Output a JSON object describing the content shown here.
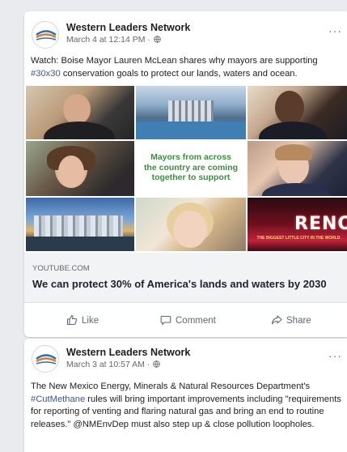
{
  "posts": [
    {
      "page_name": "Western Leaders Network",
      "date": "March 4 at 12:14 PM",
      "text_before": "Watch: Boise Mayor Lauren McLean shares why mayors are supporting ",
      "hashtag": "#30x30",
      "text_after": " conservation goals to protect our lands, waters and ocean.",
      "image_caption_lines": [
        "Mayors from across",
        "the country are coming",
        "together to support"
      ],
      "image_sign": "RENO",
      "image_sign_sub": "THE BIGGEST LITTLE CITY IN THE WORLD",
      "link": {
        "domain": "YOUTUBE.COM",
        "title": "We can protect 30% of America's lands and waters by 2030"
      },
      "actions": {
        "like": "Like",
        "comment": "Comment",
        "share": "Share"
      }
    },
    {
      "page_name": "Western Leaders Network",
      "date": "March 3 at 10:57 AM",
      "text_before": "The New Mexico Energy, Minerals & Natural Resources Department's ",
      "hashtag": "#CutMethane",
      "text_after": " rules will bring important improvements including \"requirements for reporting of venting and flaring natural gas and bring an end to routine releases.\" @NMEnvDep must also step up & close pollution loopholes."
    }
  ],
  "meta_separator": " · ",
  "more_label": "···",
  "colors": {
    "background": "#e9ebee",
    "card": "#ffffff",
    "hashtag": "#385898",
    "caption_green": "#3a8f3e",
    "muted": "#65676b"
  },
  "icons": [
    "logo-icon",
    "globe-icon",
    "more-icon",
    "like-icon",
    "comment-icon",
    "share-icon"
  ]
}
